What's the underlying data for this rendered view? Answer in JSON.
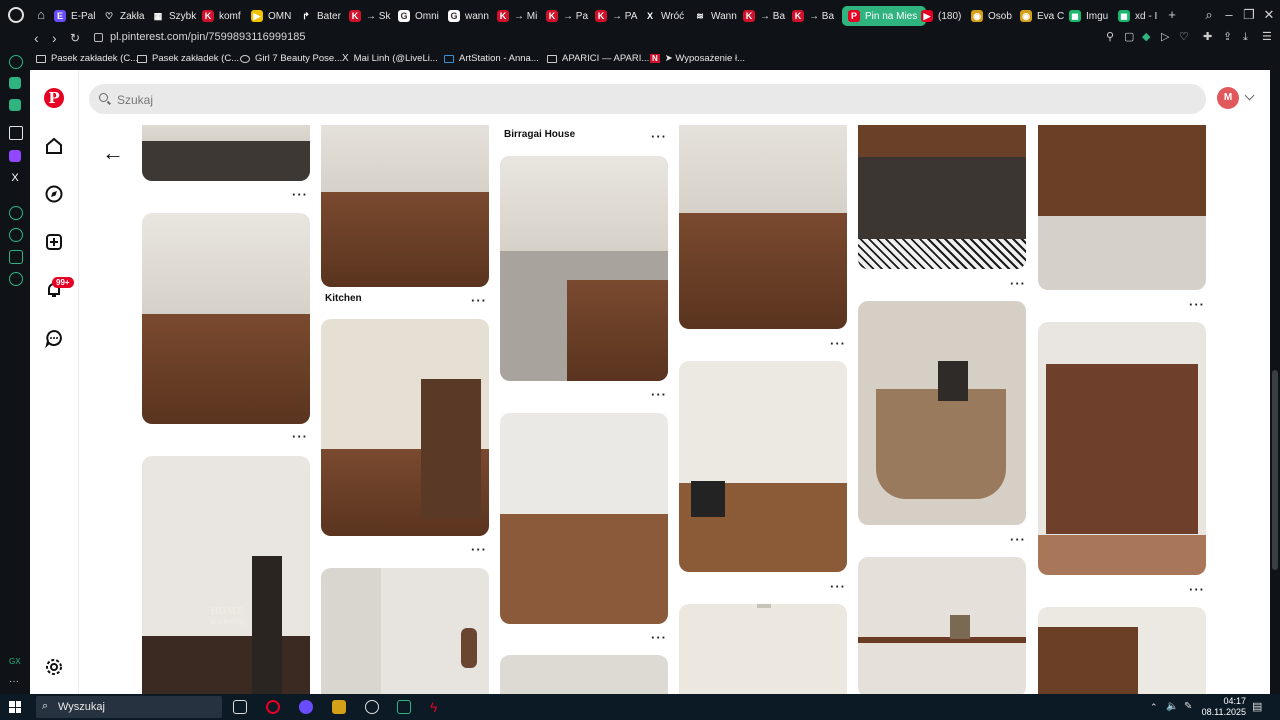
{
  "tabs": [
    {
      "label": "E-Pal",
      "fav": "E",
      "color": "#6a4cff"
    },
    {
      "label": "Zakła",
      "fav": "♡",
      "color": "#0f1318"
    },
    {
      "label": "Szybk",
      "fav": "▦",
      "color": "#0f1318"
    },
    {
      "label": "komf",
      "fav": "K",
      "color": "#d0112b"
    },
    {
      "label": "OMN",
      "fav": "▶",
      "color": "#f2c200"
    },
    {
      "label": "Bater",
      "fav": "↱",
      "color": "#0f1318"
    },
    {
      "label": "→ Sk",
      "fav": "K",
      "color": "#d0112b"
    },
    {
      "label": "Omni",
      "fav": "G",
      "color": "#ffffff"
    },
    {
      "label": "wann",
      "fav": "G",
      "color": "#ffffff"
    },
    {
      "label": "→ Mi",
      "fav": "K",
      "color": "#d0112b"
    },
    {
      "label": "→ Pa",
      "fav": "K",
      "color": "#d0112b"
    },
    {
      "label": "→ PA",
      "fav": "K",
      "color": "#d0112b"
    },
    {
      "label": "Wróć",
      "fav": "X",
      "color": "#0f1318"
    },
    {
      "label": "Wann",
      "fav": "≋",
      "color": "#0f1318"
    },
    {
      "label": "→ Ba",
      "fav": "K",
      "color": "#d0112b"
    },
    {
      "label": "→ Ba",
      "fav": "K",
      "color": "#d0112b"
    },
    {
      "label": "Pin na Mies",
      "fav": "P",
      "color": "#e60023",
      "active": true
    },
    {
      "label": "(180)",
      "fav": "▶",
      "color": "#e60023"
    },
    {
      "label": "Osob",
      "fav": "◉",
      "color": "#d4a017"
    },
    {
      "label": "Eva C",
      "fav": "◉",
      "color": "#d4a017"
    },
    {
      "label": "Imgu",
      "fav": "◼",
      "color": "#1bb76e"
    },
    {
      "label": "xd - I",
      "fav": "◼",
      "color": "#1bb76e"
    }
  ],
  "address": {
    "url": "pl.pinterest.com/pin/7599893116999185"
  },
  "bookmarks": [
    {
      "label": "Pasek zakładek (C..."
    },
    {
      "label": "Pasek zakładek (C..."
    },
    {
      "label": "Girl 7 Beauty Pose..."
    },
    {
      "label": "Mai Linh (@LiveLi..."
    },
    {
      "label": "ArtStation - Anna..."
    },
    {
      "label": "APARICI — APARI..."
    },
    {
      "label": "➤ Wyposażenie ł..."
    }
  ],
  "search": {
    "placeholder": "Szukaj"
  },
  "user": {
    "initial": "M"
  },
  "notifications": {
    "badge": "99+"
  },
  "pins": {
    "titles": {
      "birragai": "Birragai House",
      "kitchen": "Kitchen"
    },
    "home_text": "HOME",
    "home_sub": "is a feeling"
  },
  "taskbar": {
    "search_placeholder": "Wyszukaj",
    "time": "04:17",
    "date": "08.11.2025"
  }
}
